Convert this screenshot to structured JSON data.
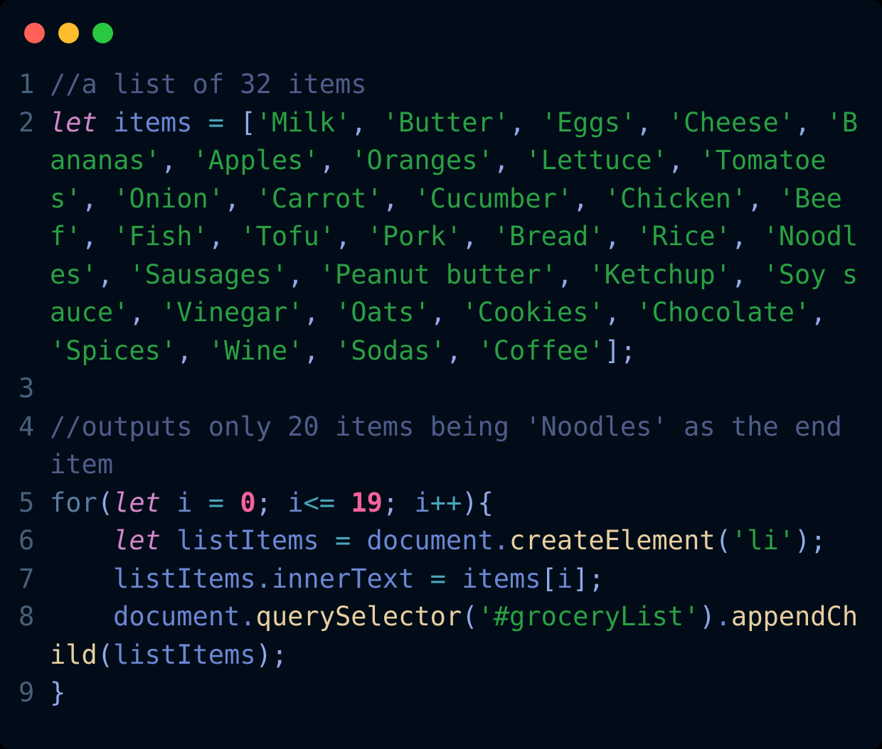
{
  "window": {
    "background_color": "#020c18",
    "traffic_lights": [
      {
        "name": "close",
        "color": "#ff6058"
      },
      {
        "name": "minimize",
        "color": "#ffbd2e"
      },
      {
        "name": "maximize",
        "color": "#28c840"
      }
    ]
  },
  "theme": {
    "gutter_color": "#48607a",
    "comment_color": "#4e5d8a",
    "keyword_color": "#d387c8",
    "control_color": "#5c7a9e",
    "identifier_color": "#6b87d4",
    "string_color": "#2aa043",
    "number_color": "#f7609f",
    "operator_color": "#49a5b8",
    "punctuation_color": "#91aae8",
    "method_color": "#e8cfa0"
  },
  "editor": {
    "language": "javascript",
    "line_numbers": [
      "1",
      "2",
      "3",
      "4",
      "5",
      "6",
      "7",
      "8",
      "9"
    ],
    "lines": [
      {
        "number": "1",
        "text": "//a list of 32 items",
        "tokens": [
          {
            "t": "//a list of 32 items",
            "c": "comment"
          }
        ]
      },
      {
        "number": "2",
        "text": "let items = ['Milk', 'Butter', 'Eggs', 'Cheese', 'Bananas', 'Apples', 'Oranges', 'Lettuce', 'Tomatoes', 'Onion', 'Carrot', 'Cucumber', 'Chicken', 'Beef', 'Fish', 'Tofu', 'Pork', 'Bread', 'Rice', 'Noodles', 'Sausages', 'Peanut butter', 'Ketchup', 'Soy sauce', 'Vinegar', 'Oats', 'Cookies', 'Chocolate', 'Spices', 'Wine', 'Sodas', 'Coffee'];",
        "tokens": [
          {
            "t": "let",
            "c": "keyword"
          },
          {
            "t": " ",
            "c": "plain"
          },
          {
            "t": "items",
            "c": "ident"
          },
          {
            "t": " ",
            "c": "plain"
          },
          {
            "t": "=",
            "c": "operator"
          },
          {
            "t": " ",
            "c": "plain"
          },
          {
            "t": "[",
            "c": "punct"
          },
          {
            "t": "'Milk'",
            "c": "string"
          },
          {
            "t": ", ",
            "c": "punct"
          },
          {
            "t": "'Butter'",
            "c": "string"
          },
          {
            "t": ", ",
            "c": "punct"
          },
          {
            "t": "'Eggs'",
            "c": "string"
          },
          {
            "t": ", ",
            "c": "punct"
          },
          {
            "t": "'Cheese'",
            "c": "string"
          },
          {
            "t": ", ",
            "c": "punct"
          },
          {
            "t": "'Bananas'",
            "c": "string"
          },
          {
            "t": ", ",
            "c": "punct"
          },
          {
            "t": "'Apples'",
            "c": "string"
          },
          {
            "t": ", ",
            "c": "punct"
          },
          {
            "t": "'Oranges'",
            "c": "string"
          },
          {
            "t": ", ",
            "c": "punct"
          },
          {
            "t": "'Lettuce'",
            "c": "string"
          },
          {
            "t": ", ",
            "c": "punct"
          },
          {
            "t": "'Tomatoes'",
            "c": "string"
          },
          {
            "t": ", ",
            "c": "punct"
          },
          {
            "t": "'Onion'",
            "c": "string"
          },
          {
            "t": ", ",
            "c": "punct"
          },
          {
            "t": "'Carrot'",
            "c": "string"
          },
          {
            "t": ", ",
            "c": "punct"
          },
          {
            "t": "'Cucumber'",
            "c": "string"
          },
          {
            "t": ", ",
            "c": "punct"
          },
          {
            "t": "'Chicken'",
            "c": "string"
          },
          {
            "t": ", ",
            "c": "punct"
          },
          {
            "t": "'Beef'",
            "c": "string"
          },
          {
            "t": ", ",
            "c": "punct"
          },
          {
            "t": "'Fish'",
            "c": "string"
          },
          {
            "t": ", ",
            "c": "punct"
          },
          {
            "t": "'Tofu'",
            "c": "string"
          },
          {
            "t": ", ",
            "c": "punct"
          },
          {
            "t": "'Pork'",
            "c": "string"
          },
          {
            "t": ", ",
            "c": "punct"
          },
          {
            "t": "'Bread'",
            "c": "string"
          },
          {
            "t": ", ",
            "c": "punct"
          },
          {
            "t": "'Rice'",
            "c": "string"
          },
          {
            "t": ", ",
            "c": "punct"
          },
          {
            "t": "'Noodles'",
            "c": "string"
          },
          {
            "t": ", ",
            "c": "punct"
          },
          {
            "t": "'Sausages'",
            "c": "string"
          },
          {
            "t": ", ",
            "c": "punct"
          },
          {
            "t": "'Peanut butter'",
            "c": "string"
          },
          {
            "t": ", ",
            "c": "punct"
          },
          {
            "t": "'Ketchup'",
            "c": "string"
          },
          {
            "t": ", ",
            "c": "punct"
          },
          {
            "t": "'Soy sauce'",
            "c": "string"
          },
          {
            "t": ", ",
            "c": "punct"
          },
          {
            "t": "'Vinegar'",
            "c": "string"
          },
          {
            "t": ", ",
            "c": "punct"
          },
          {
            "t": "'Oats'",
            "c": "string"
          },
          {
            "t": ", ",
            "c": "punct"
          },
          {
            "t": "'Cookies'",
            "c": "string"
          },
          {
            "t": ", ",
            "c": "punct"
          },
          {
            "t": "'Chocolate'",
            "c": "string"
          },
          {
            "t": ", ",
            "c": "punct"
          },
          {
            "t": "'Spices'",
            "c": "string"
          },
          {
            "t": ", ",
            "c": "punct"
          },
          {
            "t": "'Wine'",
            "c": "string"
          },
          {
            "t": ", ",
            "c": "punct"
          },
          {
            "t": "'Sodas'",
            "c": "string"
          },
          {
            "t": ", ",
            "c": "punct"
          },
          {
            "t": "'Coffee'",
            "c": "string"
          },
          {
            "t": "];",
            "c": "punct"
          }
        ]
      },
      {
        "number": "3",
        "text": "",
        "tokens": []
      },
      {
        "number": "4",
        "text": "//outputs only 20 items being 'Noodles' as the end item",
        "tokens": [
          {
            "t": "//outputs only 20 items being 'Noodles' as the end item",
            "c": "comment"
          }
        ]
      },
      {
        "number": "5",
        "text": "for(let i = 0; i<= 19; i++){",
        "tokens": [
          {
            "t": "for",
            "c": "control"
          },
          {
            "t": "(",
            "c": "punct"
          },
          {
            "t": "let",
            "c": "keyword"
          },
          {
            "t": " ",
            "c": "plain"
          },
          {
            "t": "i",
            "c": "ident"
          },
          {
            "t": " ",
            "c": "plain"
          },
          {
            "t": "=",
            "c": "operator"
          },
          {
            "t": " ",
            "c": "plain"
          },
          {
            "t": "0",
            "c": "number"
          },
          {
            "t": "; ",
            "c": "punct"
          },
          {
            "t": "i",
            "c": "ident"
          },
          {
            "t": "<=",
            "c": "operator"
          },
          {
            "t": " ",
            "c": "plain"
          },
          {
            "t": "19",
            "c": "number"
          },
          {
            "t": "; ",
            "c": "punct"
          },
          {
            "t": "i",
            "c": "ident"
          },
          {
            "t": "++",
            "c": "operator"
          },
          {
            "t": "){",
            "c": "punct"
          }
        ]
      },
      {
        "number": "6",
        "text": "    let listItems = document.createElement('li');",
        "tokens": [
          {
            "t": "    ",
            "c": "plain"
          },
          {
            "t": "let",
            "c": "keyword"
          },
          {
            "t": " ",
            "c": "plain"
          },
          {
            "t": "listItems",
            "c": "ident"
          },
          {
            "t": " ",
            "c": "plain"
          },
          {
            "t": "=",
            "c": "operator"
          },
          {
            "t": " ",
            "c": "plain"
          },
          {
            "t": "document",
            "c": "ident"
          },
          {
            "t": ".",
            "c": "dot"
          },
          {
            "t": "createElement",
            "c": "method"
          },
          {
            "t": "(",
            "c": "punct"
          },
          {
            "t": "'li'",
            "c": "string"
          },
          {
            "t": ");",
            "c": "punct"
          }
        ]
      },
      {
        "number": "7",
        "text": "    listItems.innerText = items[i];",
        "tokens": [
          {
            "t": "    ",
            "c": "plain"
          },
          {
            "t": "listItems",
            "c": "ident"
          },
          {
            "t": ".",
            "c": "dot"
          },
          {
            "t": "innerText",
            "c": "ident"
          },
          {
            "t": " ",
            "c": "plain"
          },
          {
            "t": "=",
            "c": "operator"
          },
          {
            "t": " ",
            "c": "plain"
          },
          {
            "t": "items",
            "c": "ident"
          },
          {
            "t": "[",
            "c": "punct"
          },
          {
            "t": "i",
            "c": "ident"
          },
          {
            "t": "];",
            "c": "punct"
          }
        ]
      },
      {
        "number": "8",
        "text": "    document.querySelector('#groceryList').appendChild(listItems);",
        "tokens": [
          {
            "t": "    ",
            "c": "plain"
          },
          {
            "t": "document",
            "c": "ident"
          },
          {
            "t": ".",
            "c": "dot"
          },
          {
            "t": "querySelector",
            "c": "method"
          },
          {
            "t": "(",
            "c": "punct"
          },
          {
            "t": "'#groceryList'",
            "c": "string"
          },
          {
            "t": ")",
            "c": "punct"
          },
          {
            "t": ".",
            "c": "dot"
          },
          {
            "t": "appendChild",
            "c": "method"
          },
          {
            "t": "(",
            "c": "punct"
          },
          {
            "t": "listItems",
            "c": "ident"
          },
          {
            "t": ");",
            "c": "punct"
          }
        ]
      },
      {
        "number": "9",
        "text": "}",
        "tokens": [
          {
            "t": "}",
            "c": "punct"
          }
        ]
      }
    ]
  }
}
